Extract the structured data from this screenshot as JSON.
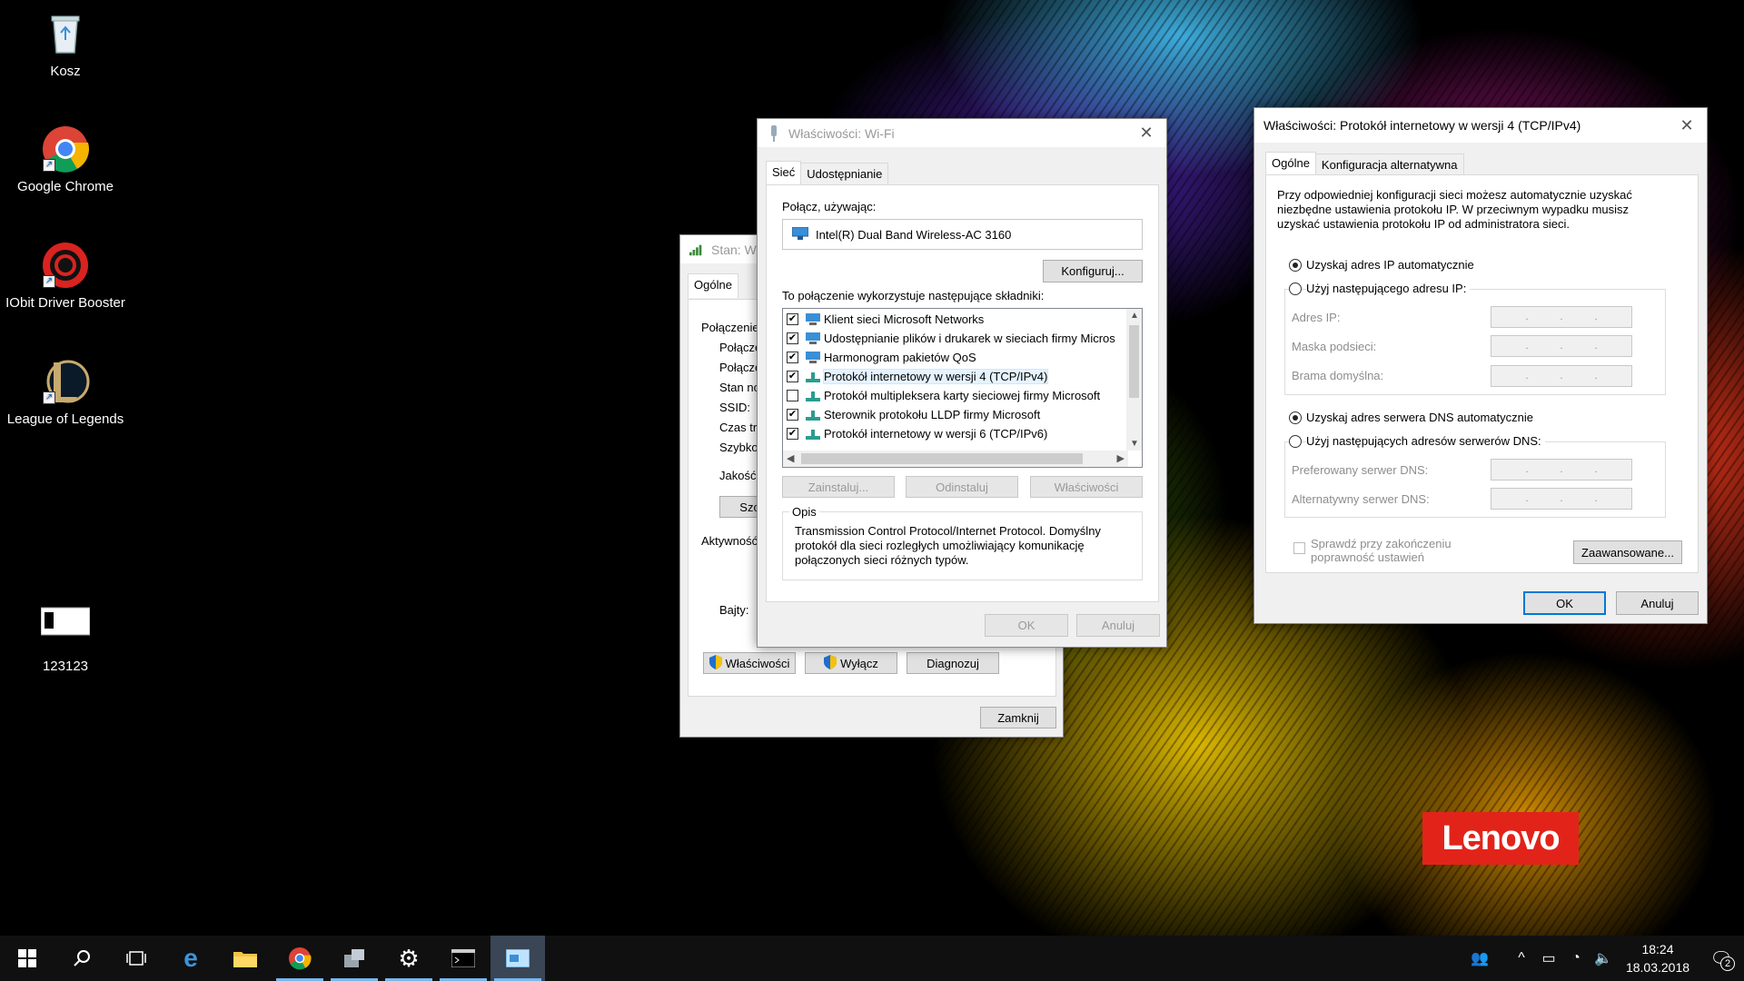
{
  "desktop": {
    "icons": [
      {
        "label": "Kosz",
        "icon": "recycle-bin-icon"
      },
      {
        "label": "Google Chrome",
        "icon": "chrome-icon"
      },
      {
        "label": "IObit Driver Booster",
        "icon": "driver-booster-icon"
      },
      {
        "label": "League of Legends",
        "icon": "league-of-legends-icon"
      },
      {
        "label": "123123",
        "icon": "file-icon"
      }
    ],
    "brand": "Lenovo"
  },
  "status_window": {
    "title": "Stan: Wi",
    "tab": "Ogólne",
    "section_connection": "Połączenie",
    "rows": [
      "Połącze",
      "Połącze",
      "Stan no",
      "SSID:",
      "Czas tr",
      "Szybkoś"
    ],
    "quality": "Jakość",
    "details_btn": "Szcze",
    "activity": "Aktywność",
    "bytes": "Bajty:",
    "properties_btn": "Właściwości",
    "disable_btn": "Wyłącz",
    "diagnose_btn": "Diagnozuj",
    "close_btn": "Zamknij"
  },
  "wifi_props": {
    "title": "Właściwości: Wi-Fi",
    "tabs": [
      "Sieć",
      "Udostępnianie"
    ],
    "connect_using": "Połącz, używając:",
    "adapter": "Intel(R) Dual Band Wireless-AC 3160",
    "configure_btn": "Konfiguruj...",
    "components_label": "To połączenie wykorzystuje następujące składniki:",
    "components": [
      {
        "label": "Klient sieci Microsoft Networks",
        "checked": true
      },
      {
        "label": "Udostępnianie plików i drukarek w sieciach firmy Micros",
        "checked": true
      },
      {
        "label": "Harmonogram pakietów QoS",
        "checked": true
      },
      {
        "label": "Protokół internetowy w wersji 4 (TCP/IPv4)",
        "checked": true
      },
      {
        "label": "Protokół multipleksera karty sieciowej firmy Microsoft",
        "checked": false
      },
      {
        "label": "Sterownik protokołu LLDP firmy Microsoft",
        "checked": true
      },
      {
        "label": "Protokół internetowy w wersji 6 (TCP/IPv6)",
        "checked": true
      }
    ],
    "install_btn": "Zainstaluj...",
    "uninstall_btn": "Odinstaluj",
    "properties_btn": "Właściwości",
    "desc_label": "Opis",
    "desc_text": "Transmission Control Protocol/Internet Protocol. Domyślny protokół dla sieci rozległych umożliwiający komunikację połączonych sieci różnych typów.",
    "ok_btn": "OK",
    "cancel_btn": "Anuluj"
  },
  "ipv4_props": {
    "title": "Właściwości: Protokół internetowy w wersji 4 (TCP/IPv4)",
    "tabs": [
      "Ogólne",
      "Konfiguracja alternatywna"
    ],
    "intro": "Przy odpowiedniej konfiguracji sieci możesz automatycznie uzyskać niezbędne ustawienia protokołu IP. W przeciwnym wypadku musisz uzyskać ustawienia protokołu IP od administratora sieci.",
    "auto_ip": "Uzyskaj adres IP automatycznie",
    "manual_ip": "Użyj następującego adresu IP:",
    "ip_address": "Adres IP:",
    "subnet_mask": "Maska podsieci:",
    "gateway": "Brama domyślna:",
    "auto_dns": "Uzyskaj adres serwera DNS automatycznie",
    "manual_dns": "Użyj następujących adresów serwerów DNS:",
    "preferred_dns": "Preferowany serwer DNS:",
    "alternate_dns": "Alternatywny serwer DNS:",
    "validate": "Sprawdź przy zakończeniu poprawność ustawień",
    "advanced_btn": "Zaawansowane...",
    "ok_btn": "OK",
    "cancel_btn": "Anuluj"
  },
  "taskbar": {
    "time": "18:24",
    "date": "18.03.2018",
    "notifications": "2"
  }
}
